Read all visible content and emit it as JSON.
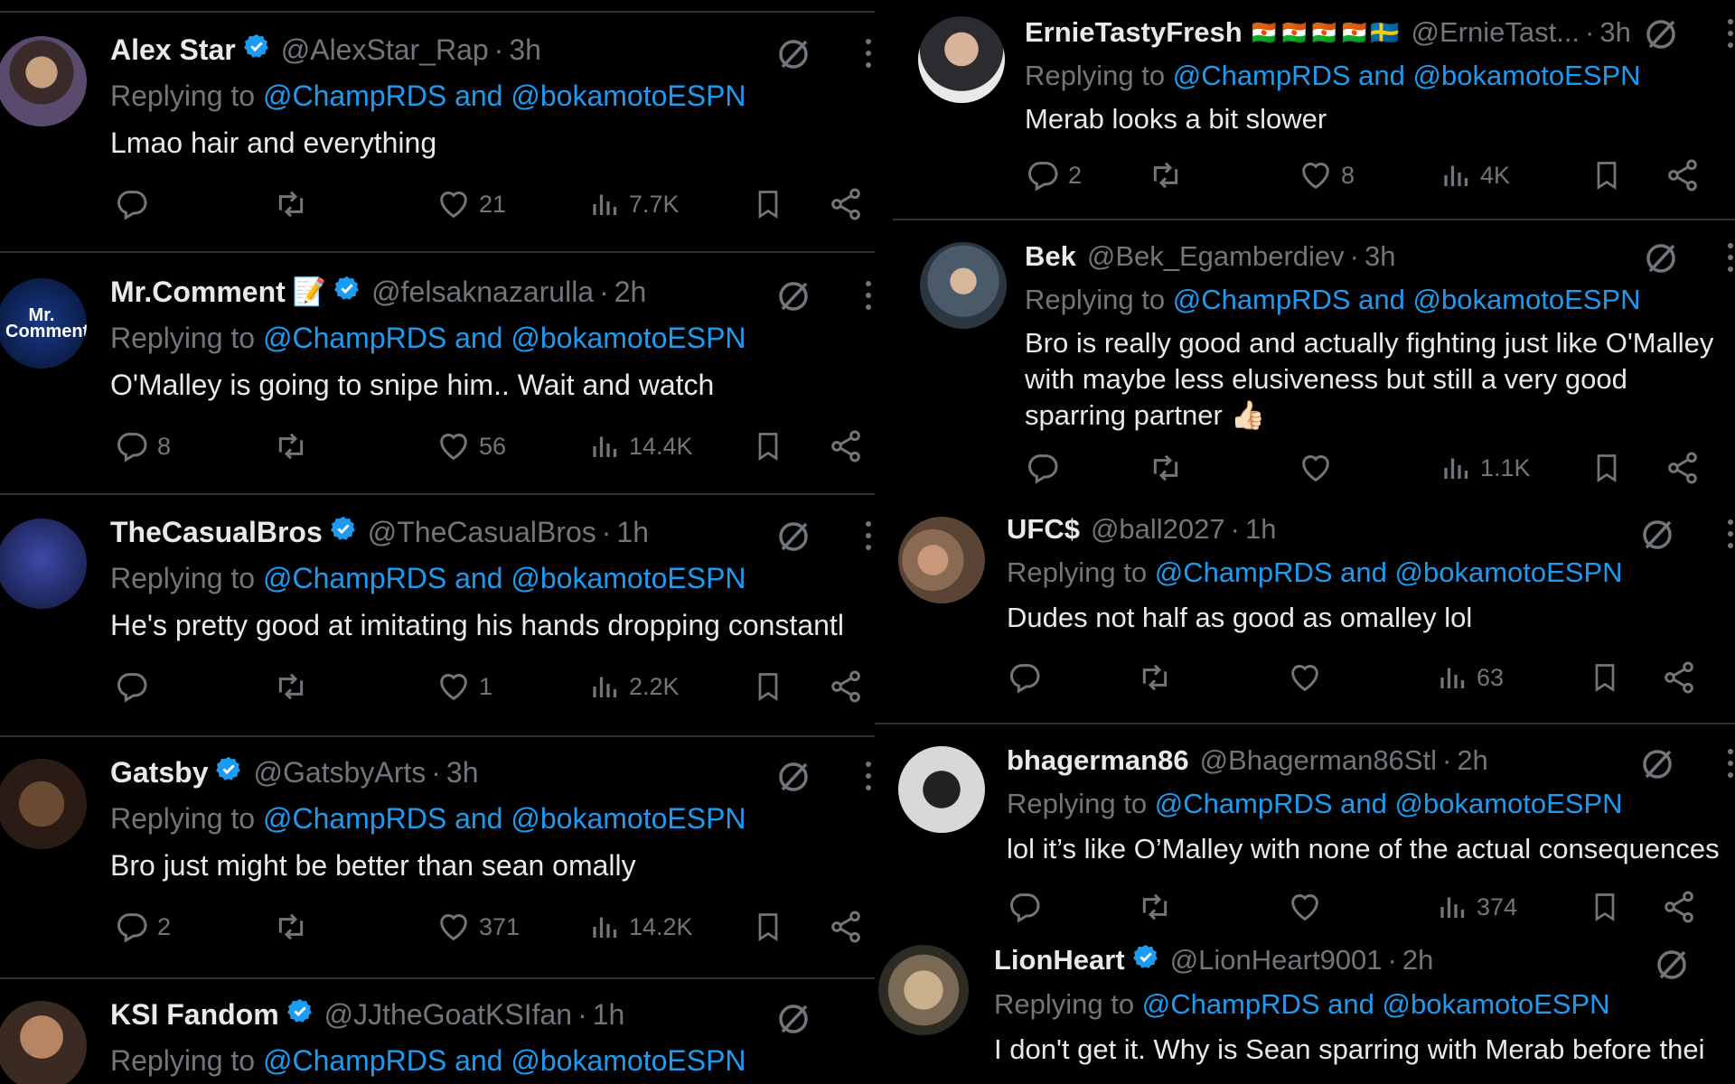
{
  "reply_label": "Replying to",
  "reply_mentions": "@ChampRDS and @bokamotoESPN",
  "left_tweets": [
    {
      "name": "Alex Star",
      "handle": "@AlexStar_Rap",
      "time": "3h",
      "text": "Lmao hair and everything",
      "replies": "",
      "likes": "21",
      "views": "7.7K"
    },
    {
      "name": "Mr.Comment",
      "emoji": "📝",
      "handle": "@felsaknazarulla",
      "time": "2h",
      "text": "O'Malley is going to snipe him.. Wait and watch",
      "replies": "8",
      "likes": "56",
      "views": "14.4K",
      "avatar_text": "Mr. Comment"
    },
    {
      "name": "TheCasualBros",
      "handle": "@TheCasualBros",
      "time": "1h",
      "text": "He's pretty good at imitating his hands dropping constantl",
      "replies": "",
      "likes": "1",
      "views": "2.2K"
    },
    {
      "name": "Gatsby",
      "handle": "@GatsbyArts",
      "time": "3h",
      "text": "Bro just might be better than sean omally",
      "replies": "2",
      "likes": "371",
      "views": "14.2K"
    },
    {
      "name": "KSI Fandom",
      "handle": "@JJtheGoatKSIfan",
      "time": "1h",
      "text": "",
      "replies": "",
      "likes": "",
      "views": ""
    }
  ],
  "right_tweets": [
    {
      "name": "ErnieTastyFresh",
      "flags": "🇳🇪🇳🇪🇳🇪🇳🇪🇸🇪",
      "handle": "@ErnieTast...",
      "time": "3h",
      "text": "Merab looks a bit slower",
      "replies": "2",
      "likes": "8",
      "views": "4K"
    },
    {
      "name": "Bek",
      "handle": "@Bek_Egamberdiev",
      "time": "3h",
      "text": "Bro is really good and actually fighting just like O'Malley with maybe less elusiveness but still a very good sparring partner 👍🏻",
      "replies": "",
      "likes": "",
      "views": "1.1K"
    },
    {
      "name": "UFC$",
      "handle": "@ball2027",
      "time": "1h",
      "text": "Dudes not half as good as omalley lol",
      "replies": "",
      "likes": "",
      "views": "63"
    },
    {
      "name": "bhagerman86",
      "handle": "@Bhagerman86Stl",
      "time": "2h",
      "text": "lol it’s like O’Malley with none of the actual consequences",
      "replies": "",
      "likes": "",
      "views": "374"
    },
    {
      "name": "LionHeart",
      "handle": "@LionHeart9001",
      "time": "2h",
      "text": "I don't get it. Why is Sean sparring with Merab before thei",
      "replies": "",
      "likes": "",
      "views": ""
    }
  ],
  "colors": {
    "background": "#000000",
    "text": "#e7e9ea",
    "muted": "#71767b",
    "link": "#1d9bf0",
    "verified": "#1d9bf0",
    "divider": "#2f3336"
  }
}
